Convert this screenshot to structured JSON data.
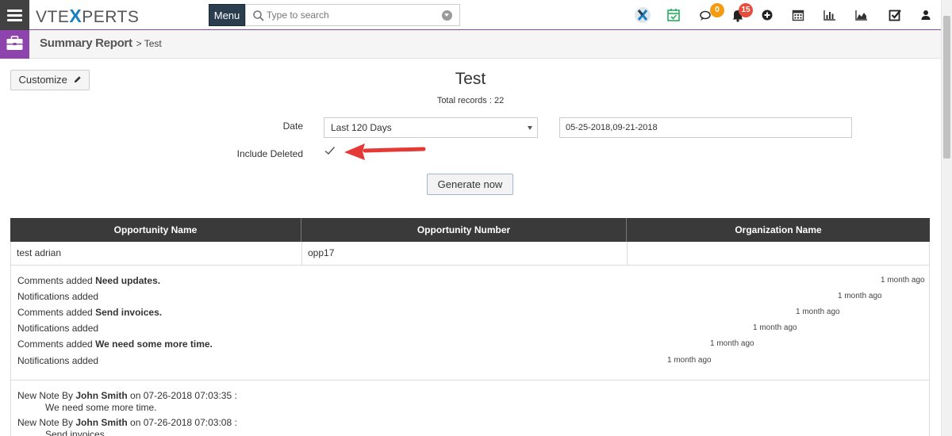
{
  "header": {
    "logo_prefix": "VTE",
    "logo_x": "X",
    "logo_suffix": "PERTS",
    "menu_label": "Menu",
    "search_placeholder": "Type to search",
    "chat_badge": "0",
    "notification_badge": "15",
    "badge_colors": {
      "chat": "#f39c12",
      "notification": "#e74c3c"
    }
  },
  "breadcrumb": {
    "module": "Summary Report",
    "separator": ">",
    "current": "Test"
  },
  "toolbar": {
    "customize_label": "Customize"
  },
  "report": {
    "title": "Test",
    "total_records": "Total records : 22"
  },
  "filters": {
    "date_label": "Date",
    "date_option": "Last 120 Days",
    "date_range": "05-25-2018,09-21-2018",
    "include_deleted_label": "Include Deleted",
    "include_deleted_checked": true,
    "generate_label": "Generate now"
  },
  "table": {
    "columns": [
      "Opportunity Name",
      "Opportunity Number",
      "Organization Name"
    ],
    "rows": [
      {
        "name": "test adrian",
        "number": "opp17",
        "organization": ""
      }
    ]
  },
  "updates": [
    {
      "prefix": "Comments added ",
      "bold": "Need updates.",
      "time": "1 month ago"
    },
    {
      "prefix": "Notifications added",
      "bold": "",
      "time": "1 month ago"
    },
    {
      "prefix": "Comments added ",
      "bold": "Send invoices.",
      "time": "1 month ago"
    },
    {
      "prefix": "Notifications added",
      "bold": "",
      "time": "1 month ago"
    },
    {
      "prefix": "Comments added ",
      "bold": "We need some more time.",
      "time": "1 month ago"
    },
    {
      "prefix": "Notifications added",
      "bold": "",
      "time": "1 month ago"
    }
  ],
  "notes": [
    {
      "prefix": "New Note By ",
      "author": "John Smith",
      "suffix": " on 07-26-2018 07:03:35 :",
      "body": "We need some more time."
    },
    {
      "prefix": "New Note By ",
      "author": "John Smith",
      "suffix": " on 07-26-2018 07:03:08 :",
      "body": "Send invoices."
    }
  ],
  "colors": {
    "accent": "#8e44ad",
    "nav_dark": "#424242",
    "table_header": "#3a3a3a",
    "arrow": "#e53935"
  }
}
